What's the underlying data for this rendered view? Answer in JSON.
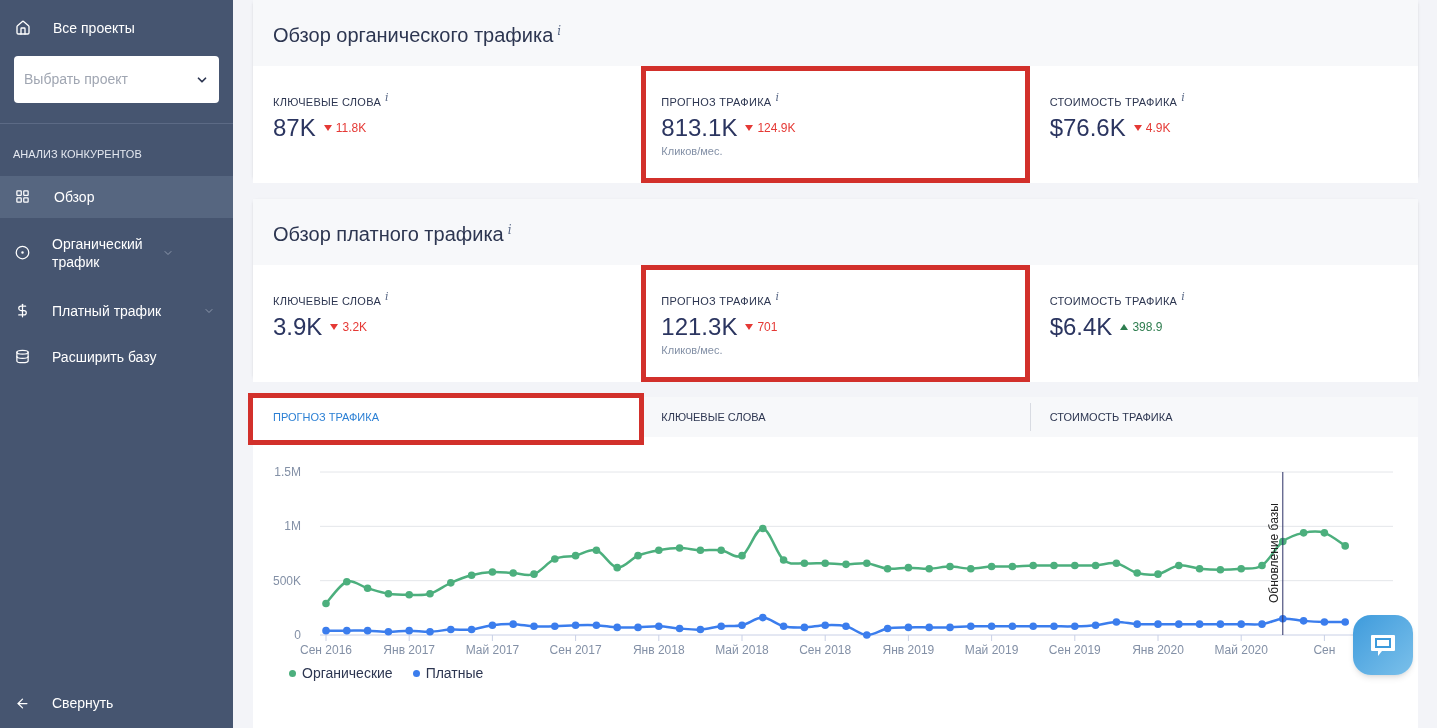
{
  "sidebar": {
    "all_projects": "Все проекты",
    "project_select": {
      "placeholder": "Выбрать проект"
    },
    "section": "АНАЛИЗ КОНКУРЕНТОВ",
    "items": [
      {
        "label": "Обзор",
        "selected": true
      },
      {
        "label": "Органический трафик",
        "selected": false,
        "expanded": false
      },
      {
        "label": "Платный трафик",
        "selected": false,
        "expanded": false
      },
      {
        "label": "Расширить базу",
        "selected": false
      }
    ],
    "collapse": "Свернуть"
  },
  "sections": [
    {
      "title": "Обзор органического трафика",
      "hint": "i",
      "metrics": [
        {
          "label": "КЛЮЧЕВЫЕ СЛОВА",
          "hint": "i",
          "value": "87K",
          "delta": "11.8K",
          "rising": false,
          "highlighted": false
        },
        {
          "label": "ПРОГНОЗ ТРАФИКА",
          "hint": "i",
          "value": "813.1K",
          "delta": "124.9K",
          "rising": false,
          "caption": "Кликов/мес.",
          "highlighted": true
        },
        {
          "label": "СТОИМОСТЬ ТРАФИКА",
          "hint": "i",
          "value": "$76.6K",
          "delta": "4.9K",
          "rising": false,
          "highlighted": false
        }
      ]
    },
    {
      "title": "Обзор платного трафика",
      "hint": "i",
      "metrics": [
        {
          "label": "КЛЮЧЕВЫЕ СЛОВА",
          "hint": "i",
          "value": "3.9K",
          "delta": "3.2K",
          "rising": false,
          "highlighted": false
        },
        {
          "label": "ПРОГНОЗ ТРАФИКА",
          "hint": "i",
          "value": "121.3K",
          "delta": "701",
          "rising": false,
          "caption": "Кликов/мес.",
          "highlighted": true
        },
        {
          "label": "СТОИМОСТЬ ТРАФИКА",
          "hint": "i",
          "value": "$6.4K",
          "delta": "398.9",
          "rising": true,
          "highlighted": false
        }
      ]
    }
  ],
  "tabs": [
    {
      "label": "ПРОГНОЗ ТРАФИКА",
      "selected": true,
      "highlighted": true
    },
    {
      "label": "КЛЮЧЕВЫЕ СЛОВА",
      "selected": false,
      "highlighted": false
    },
    {
      "label": "СТОИМОСТЬ ТРАФИКА",
      "selected": false,
      "highlighted": false
    }
  ],
  "chart_data": {
    "type": "line",
    "categories": [
      "Сен 2016",
      null,
      null,
      null,
      "Янв 2017",
      null,
      null,
      null,
      "Май 2017",
      null,
      null,
      null,
      "Сен 2017",
      null,
      null,
      null,
      "Янв 2018",
      null,
      null,
      null,
      "Май 2018",
      null,
      null,
      null,
      "Сен 2018",
      null,
      null,
      null,
      "Янв 2019",
      null,
      null,
      null,
      "Май 2019",
      null,
      null,
      null,
      "Сен 2019",
      null,
      null,
      null,
      "Янв 2020",
      null,
      null,
      null,
      "Май 2020",
      null,
      null,
      null,
      "Сен",
      null
    ],
    "ylim": [
      0,
      1500000
    ],
    "yticks": [
      {
        "value": 0,
        "label": "0"
      },
      {
        "value": 500000,
        "label": "500K"
      },
      {
        "value": 1000000,
        "label": "1M"
      },
      {
        "value": 1500000,
        "label": "1.5M"
      }
    ],
    "series": [
      {
        "name": "Органические",
        "color": "#4caf7d",
        "marker": "circle",
        "values": [
          290000,
          490000,
          430000,
          380000,
          370000,
          380000,
          480000,
          550000,
          580000,
          570000,
          560000,
          700000,
          730000,
          780000,
          620000,
          730000,
          780000,
          800000,
          780000,
          780000,
          730000,
          980000,
          690000,
          660000,
          660000,
          650000,
          660000,
          610000,
          620000,
          610000,
          630000,
          610000,
          630000,
          630000,
          640000,
          640000,
          640000,
          640000,
          660000,
          570000,
          560000,
          640000,
          610000,
          600000,
          610000,
          640000,
          860000,
          940000,
          940000,
          820000
        ]
      },
      {
        "name": "Платные",
        "color": "#3b7ded",
        "marker": "circle",
        "values": [
          40000,
          40000,
          40000,
          30000,
          40000,
          30000,
          50000,
          50000,
          90000,
          100000,
          80000,
          80000,
          90000,
          90000,
          70000,
          70000,
          80000,
          60000,
          50000,
          80000,
          90000,
          160000,
          80000,
          70000,
          90000,
          80000,
          0,
          60000,
          70000,
          70000,
          70000,
          80000,
          80000,
          80000,
          80000,
          80000,
          80000,
          90000,
          120000,
          100000,
          100000,
          100000,
          100000,
          100000,
          100000,
          100000,
          150000,
          130000,
          120000,
          120000
        ]
      }
    ],
    "annotations": [
      "Обновление базы"
    ]
  }
}
